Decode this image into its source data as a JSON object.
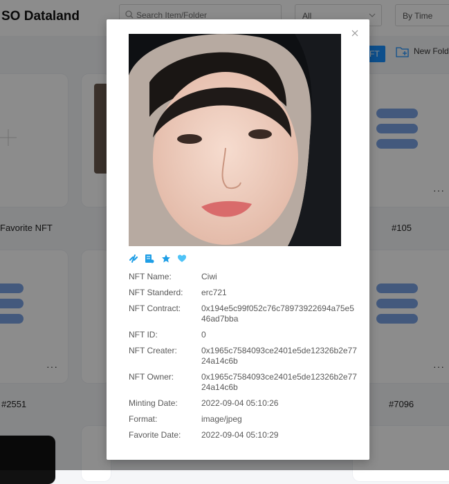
{
  "app": {
    "title": "SO Dataland"
  },
  "search": {
    "placeholder": "Search Item/Folder"
  },
  "filters": {
    "type_value": "All",
    "sort_value": "By Time"
  },
  "toolbar": {
    "button_label": "FT",
    "new_folder_label": "New Fold"
  },
  "cards": {
    "favorite_label": "Favorite NFT",
    "items": [
      "#105",
      "#2551",
      "#7096"
    ]
  },
  "modal": {
    "fields": [
      {
        "label": "NFT Name:",
        "value": "Ciwi"
      },
      {
        "label": "NFT Standerd:",
        "value": "erc721"
      },
      {
        "label": "NFT Contract:",
        "value": "0x194e5c99f052c76c78973922694a75e546ad7bba"
      },
      {
        "label": "NFT ID:",
        "value": "0"
      },
      {
        "label": "NFT Creater:",
        "value": "0x1965c7584093ce2401e5de12326b2e7724a14c6b"
      },
      {
        "label": "NFT Owner:",
        "value": "0x1965c7584093ce2401e5de12326b2e7724a14c6b"
      },
      {
        "label": "Minting Date:",
        "value": "2022-09-04 05:10:26"
      },
      {
        "label": "Format:",
        "value": "image/jpeg"
      },
      {
        "label": "Favorite Date:",
        "value": "2022-09-04 05:10:29"
      }
    ],
    "badges": [
      "link-icon",
      "certificate-icon",
      "star-icon",
      "heart-icon"
    ]
  },
  "colors": {
    "accent": "#1890ff",
    "badge": "#1e9ee6",
    "overlay": "rgba(0,0,0,0.45)"
  }
}
